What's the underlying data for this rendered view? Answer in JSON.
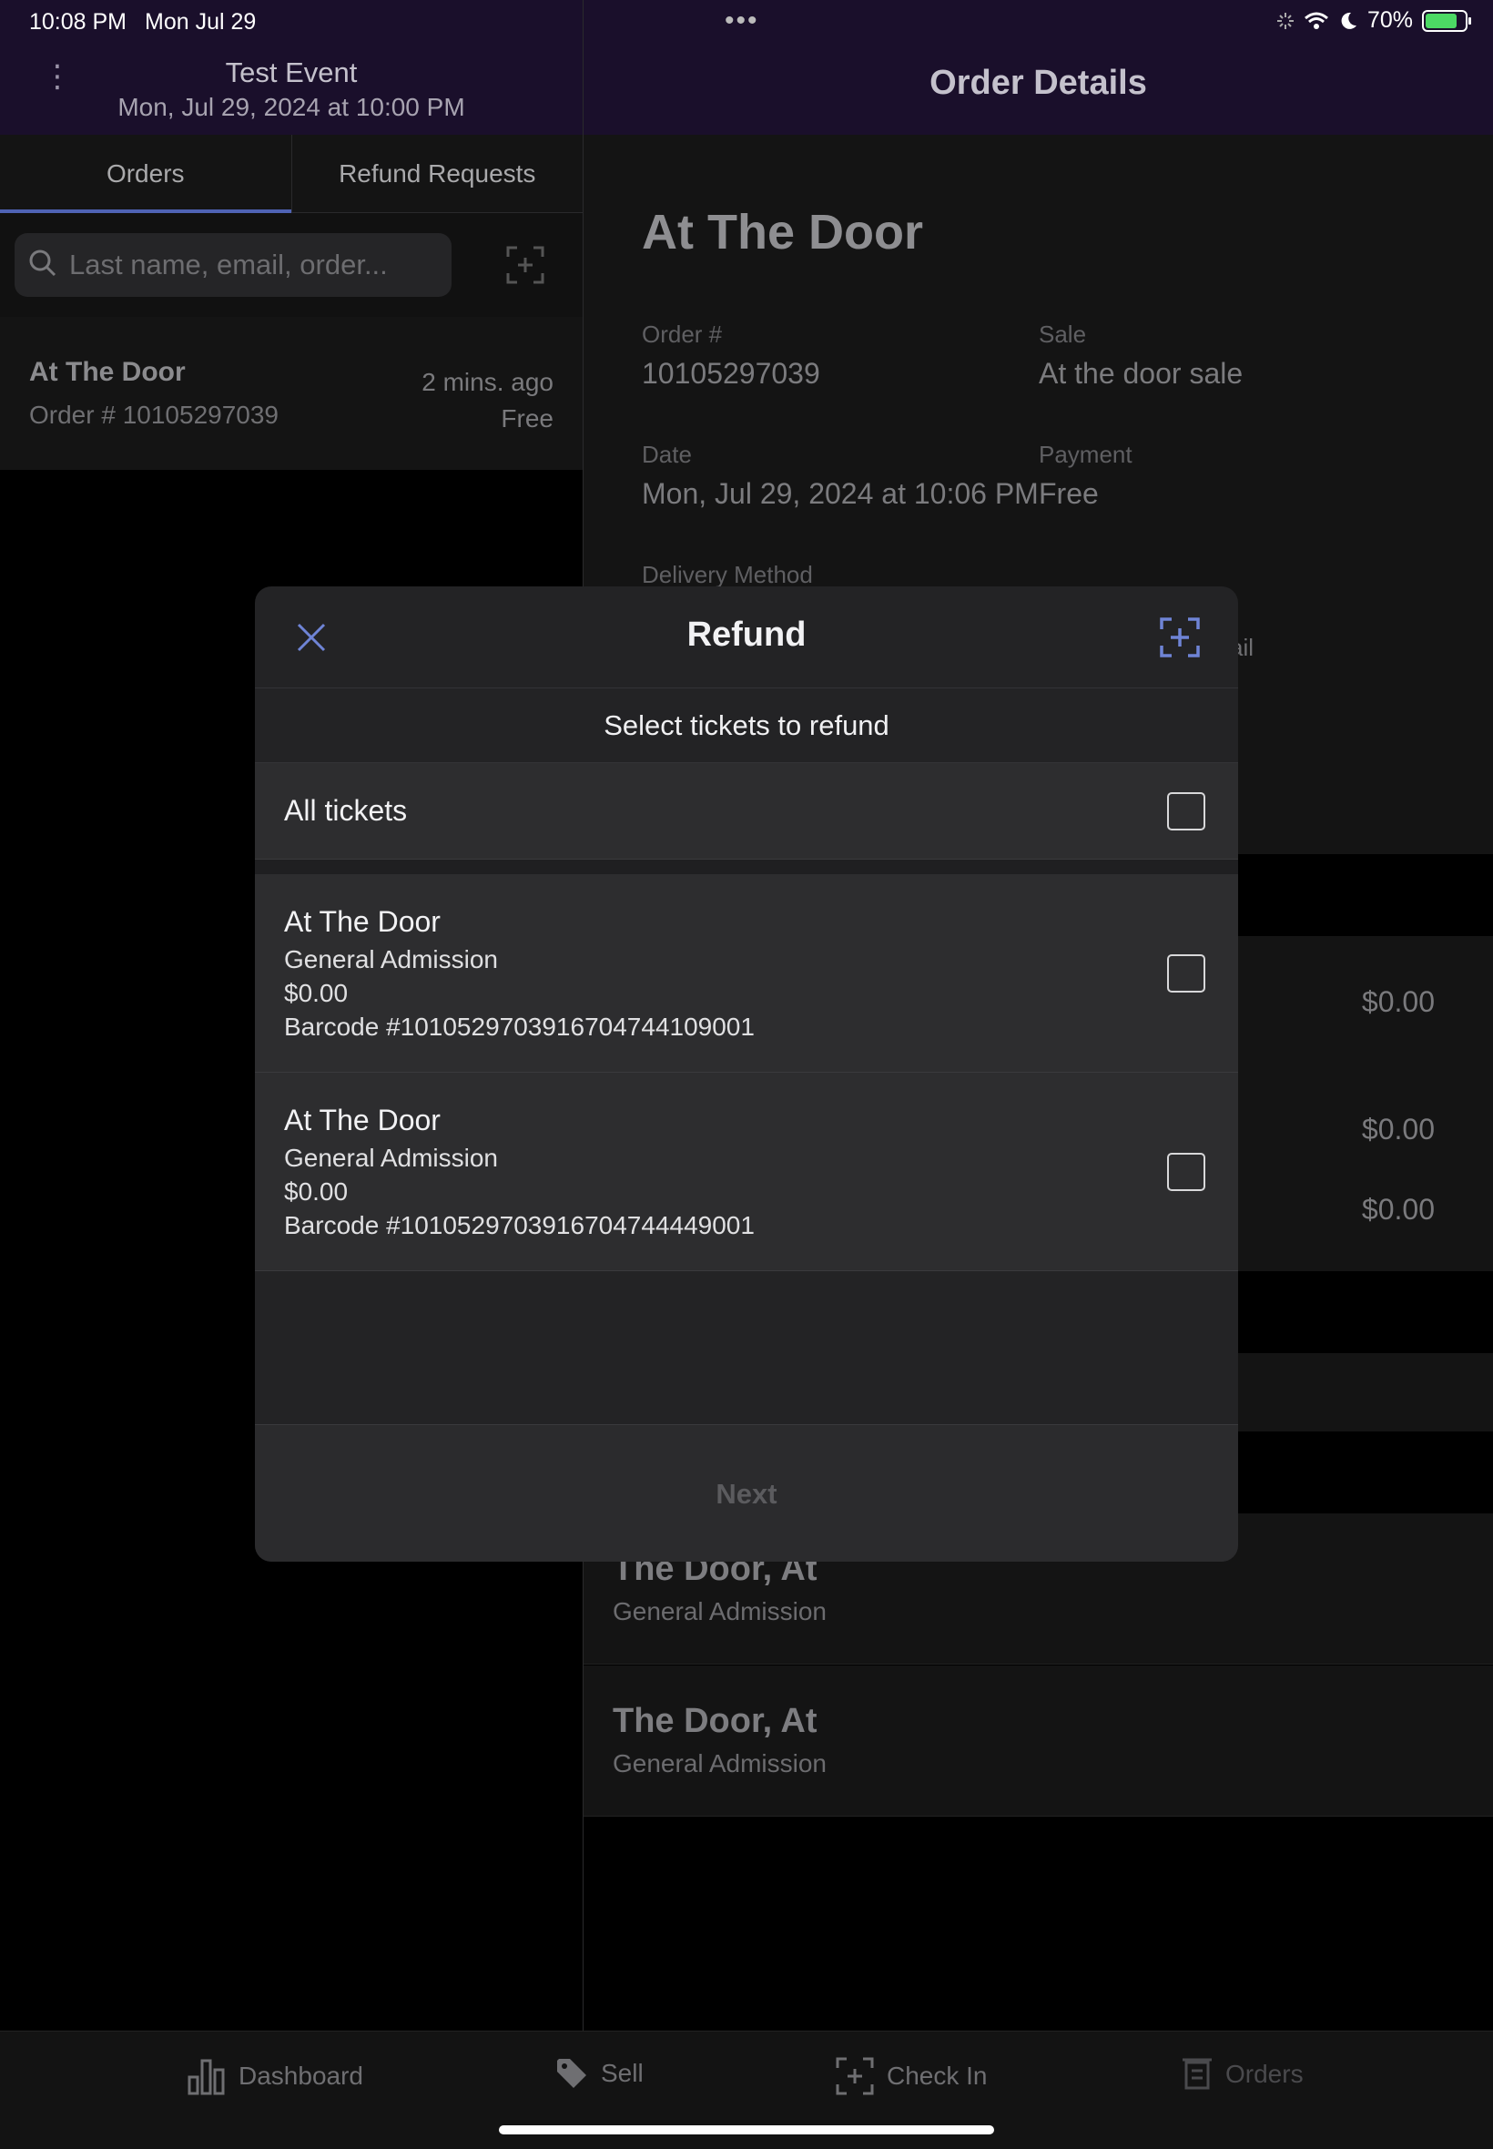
{
  "status_bar": {
    "time": "10:08 PM",
    "date": "Mon Jul 29",
    "battery": "70%"
  },
  "left_header": {
    "title": "Test Event",
    "subtitle": "Mon, Jul 29, 2024 at 10:00 PM"
  },
  "right_header": {
    "title": "Order Details"
  },
  "tabs": [
    {
      "label": "Orders"
    },
    {
      "label": "Refund Requests"
    }
  ],
  "search": {
    "placeholder": "Last name, email, order..."
  },
  "order_list": [
    {
      "title": "At The Door",
      "order": "Order # 10105297039",
      "time": "2 mins. ago",
      "price": "Free"
    }
  ],
  "detail": {
    "title": "At The Door",
    "order_label": "Order #",
    "order_value": "10105297039",
    "sale_label": "Sale",
    "sale_value": "At the door sale",
    "date_label": "Date",
    "date_value": "Mon, Jul 29, 2024 at 10:06 PM",
    "payment_label": "Payment",
    "payment_value": "Free",
    "delivery_label": "Delivery Method",
    "email_partial": "ail",
    "prices": [
      "$0.00",
      "$0.00",
      "$0.00"
    ],
    "attendees": [
      {
        "name": "The Door, At",
        "type": "General Admission"
      },
      {
        "name": "The Door, At",
        "type": "General Admission"
      }
    ]
  },
  "modal": {
    "title": "Refund",
    "subtitle": "Select tickets to refund",
    "all_label": "All tickets",
    "tickets": [
      {
        "name": "At The Door",
        "type": "General Admission",
        "price": "$0.00",
        "barcode": "Barcode #1010529703916704744109001",
        "checked": false
      },
      {
        "name": "At The Door",
        "type": "General Admission",
        "price": "$0.00",
        "barcode": "Barcode #1010529703916704744449001",
        "checked": false
      }
    ],
    "next_label": "Next"
  },
  "bottom_nav": [
    {
      "label": "Dashboard",
      "icon": "bar-chart-icon"
    },
    {
      "label": "Sell",
      "icon": "tag-icon"
    },
    {
      "label": "Check In",
      "icon": "scan-icon"
    },
    {
      "label": "Orders",
      "icon": "receipt-icon"
    }
  ],
  "colors": {
    "accent": "#4f63b4",
    "header_bg": "#1a0f2b",
    "modal_bg": "#232325"
  }
}
